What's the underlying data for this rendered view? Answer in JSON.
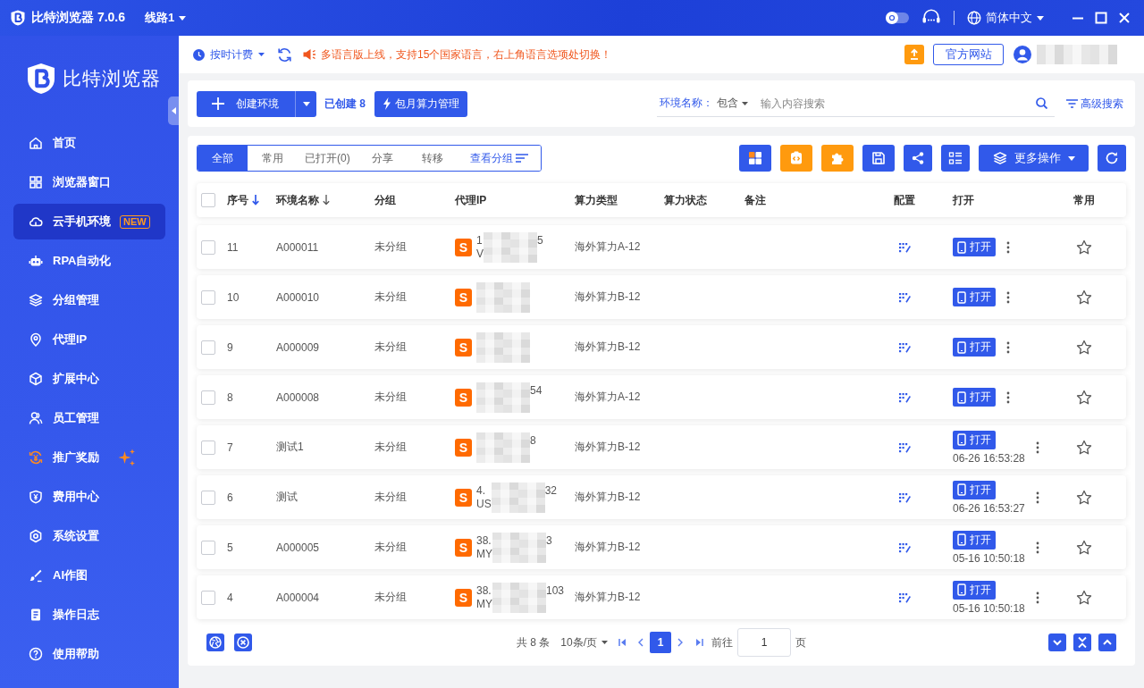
{
  "title_bar": {
    "app_name": "比特浏览器 7.0.6",
    "route": "线路1",
    "dark_mode": false,
    "language": "简体中文"
  },
  "sidebar": {
    "logo_text": "比特浏览器",
    "items": [
      {
        "label": "首页",
        "selected": false,
        "highlight": false
      },
      {
        "label": "浏览器窗口",
        "selected": false,
        "highlight": false
      },
      {
        "label": "云手机环境",
        "selected": true,
        "highlight": false,
        "badge": "NEW"
      },
      {
        "label": "RPA自动化",
        "selected": false,
        "highlight": false
      },
      {
        "label": "分组管理",
        "selected": false,
        "highlight": false
      },
      {
        "label": "代理IP",
        "selected": false,
        "highlight": false
      },
      {
        "label": "扩展中心",
        "selected": false,
        "highlight": false
      },
      {
        "label": "员工管理",
        "selected": false,
        "highlight": false
      },
      {
        "label": "推广奖励",
        "selected": false,
        "highlight": true
      },
      {
        "label": "费用中心",
        "selected": false,
        "highlight": false
      },
      {
        "label": "系统设置",
        "selected": false,
        "highlight": false
      },
      {
        "label": "AI作图",
        "selected": false,
        "highlight": false
      },
      {
        "label": "操作日志",
        "selected": false,
        "highlight": false
      },
      {
        "label": "使用帮助",
        "selected": false,
        "highlight": false
      }
    ]
  },
  "top_bar": {
    "billing": "按时计费",
    "notice": "多语言版上线，支持15个国家语言，右上角语言选项处切换！",
    "website_button": "官方网站"
  },
  "toolbar": {
    "create_button": "创建环境",
    "created_count": "已创建 8",
    "monthly_button": "包月算力管理",
    "search_label": "环境名称：",
    "match_mode": "包含",
    "search": {
      "placeholder": "输入内容搜索"
    },
    "advanced_search": "高级搜索"
  },
  "filter_tabs": [
    {
      "label": "全部",
      "selected": true
    },
    {
      "label": "常用",
      "selected": false
    },
    {
      "label": "已打开(0)",
      "selected": false
    },
    {
      "label": "分享",
      "selected": false
    },
    {
      "label": "转移",
      "selected": false
    }
  ],
  "group_view": "查看分组",
  "more_actions": "更多操作",
  "table": {
    "select_all_checked": false,
    "columns": [
      {
        "label": "序号",
        "sortable": true,
        "sort_active": true
      },
      {
        "label": "环境名称",
        "sortable": true,
        "sort_active": false
      },
      {
        "label": "分组",
        "sortable": false,
        "sort_active": false
      },
      {
        "label": "代理IP",
        "sortable": false,
        "sort_active": false
      },
      {
        "label": "算力类型",
        "sortable": false,
        "sort_active": false
      },
      {
        "label": "算力状态",
        "sortable": false,
        "sort_active": false
      },
      {
        "label": "备注",
        "sortable": false,
        "sort_active": false
      },
      {
        "label": "配置",
        "sortable": false,
        "sort_active": false
      },
      {
        "label": "打开",
        "sortable": false,
        "sort_active": false
      },
      {
        "label": "常用",
        "sortable": false,
        "sort_active": false
      }
    ],
    "rows": [
      {
        "checked": false,
        "number": "11",
        "name": "A000011",
        "group": "未分组",
        "proxy_badge": "S",
        "proxy_start": "1",
        "proxy_end": "5",
        "proxy_region": "V",
        "compute_type": "海外算力A-12",
        "open_button": "打开",
        "starred": false
      },
      {
        "checked": false,
        "number": "10",
        "name": "A000010",
        "group": "未分组",
        "proxy_badge": "S",
        "compute_type": "海外算力B-12",
        "open_button": "打开",
        "starred": false
      },
      {
        "checked": false,
        "number": "9",
        "name": "A000009",
        "group": "未分组",
        "proxy_badge": "S",
        "compute_type": "海外算力B-12",
        "open_button": "打开",
        "starred": false
      },
      {
        "checked": false,
        "number": "8",
        "name": "A000008",
        "group": "未分组",
        "proxy_badge": "S",
        "proxy_end": "54",
        "compute_type": "海外算力A-12",
        "open_button": "打开",
        "starred": false
      },
      {
        "checked": false,
        "number": "7",
        "name": "测试1",
        "group": "未分组",
        "proxy_badge": "S",
        "proxy_end": "8",
        "compute_type": "海外算力B-12",
        "open_button": "打开",
        "opened_at": "06-26 16:53:28",
        "starred": false
      },
      {
        "checked": false,
        "number": "6",
        "name": "测试",
        "group": "未分组",
        "proxy_badge": "S",
        "proxy_start": "4.",
        "proxy_end": "32",
        "proxy_region": "US",
        "compute_type": "海外算力B-12",
        "open_button": "打开",
        "opened_at": "06-26 16:53:27",
        "starred": false
      },
      {
        "checked": false,
        "number": "5",
        "name": "A000005",
        "group": "未分组",
        "proxy_badge": "S",
        "proxy_start": "38.",
        "proxy_end": "3",
        "proxy_region": "MY",
        "compute_type": "海外算力B-12",
        "open_button": "打开",
        "opened_at": "05-16 10:50:18",
        "starred": false
      },
      {
        "checked": false,
        "number": "4",
        "name": "A000004",
        "group": "未分组",
        "proxy_badge": "S",
        "proxy_start": "38.",
        "proxy_end": "103",
        "proxy_region": "MY",
        "compute_type": "海外算力B-12",
        "open_button": "打开",
        "opened_at": "05-16 10:50:18",
        "starred": false
      }
    ]
  },
  "footer": {
    "total": "共 8 条",
    "page_size": "10条/页",
    "pages": [
      {
        "label": "1",
        "selected": true
      }
    ],
    "goto_label": "前往",
    "goto_value": "1",
    "page_unit": "页"
  }
}
